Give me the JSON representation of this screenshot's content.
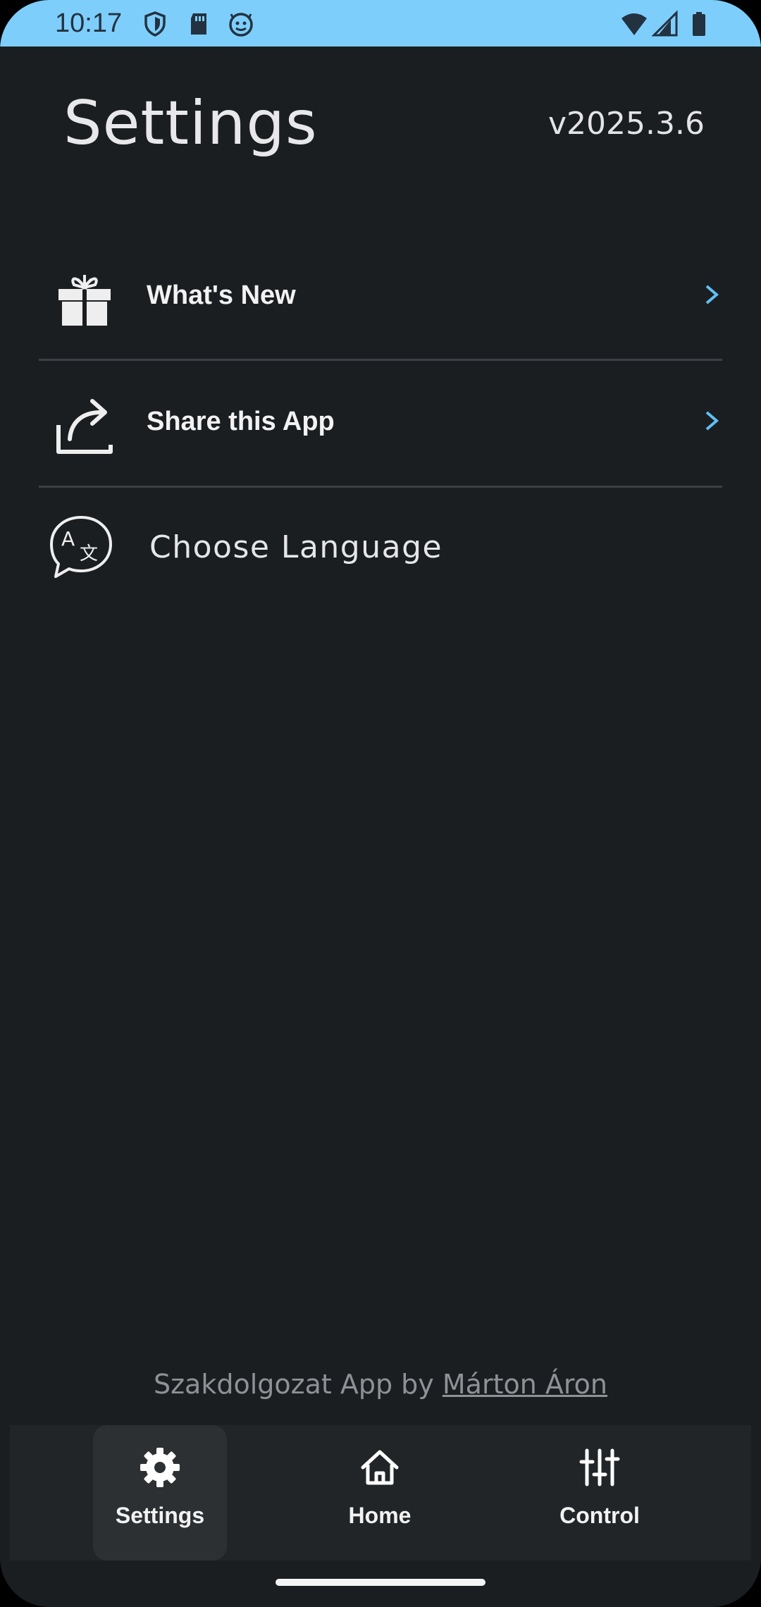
{
  "status_bar": {
    "time": "10:17",
    "left_icons": [
      "shield-icon",
      "sd-card-icon",
      "face-icon"
    ],
    "right_icons": [
      "wifi-icon",
      "signal-icon",
      "battery-icon"
    ],
    "background": "#7ecefc"
  },
  "header": {
    "title": "Settings",
    "version": "v2025.3.6"
  },
  "menu": {
    "items": [
      {
        "label": "What's New",
        "icon": "gift-icon",
        "has_chevron": true
      },
      {
        "label": "Share this App",
        "icon": "share-icon",
        "has_chevron": true
      },
      {
        "label": "Choose Language",
        "icon": "translate-icon",
        "has_chevron": false
      }
    ],
    "chevron_color": "#5fc0f5"
  },
  "footer": {
    "credit_prefix": "Szakdolgozat App by",
    "credit_author": "Márton Áron"
  },
  "bottom_nav": {
    "items": [
      {
        "label": "Settings",
        "icon": "gear-icon",
        "active": true
      },
      {
        "label": "Home",
        "icon": "home-icon",
        "active": false
      },
      {
        "label": "Control",
        "icon": "sliders-icon",
        "active": false
      }
    ]
  },
  "colors": {
    "background": "#1b1e21",
    "divider": "#3c4045",
    "nav_background": "#222527",
    "nav_active": "#2d3033"
  }
}
